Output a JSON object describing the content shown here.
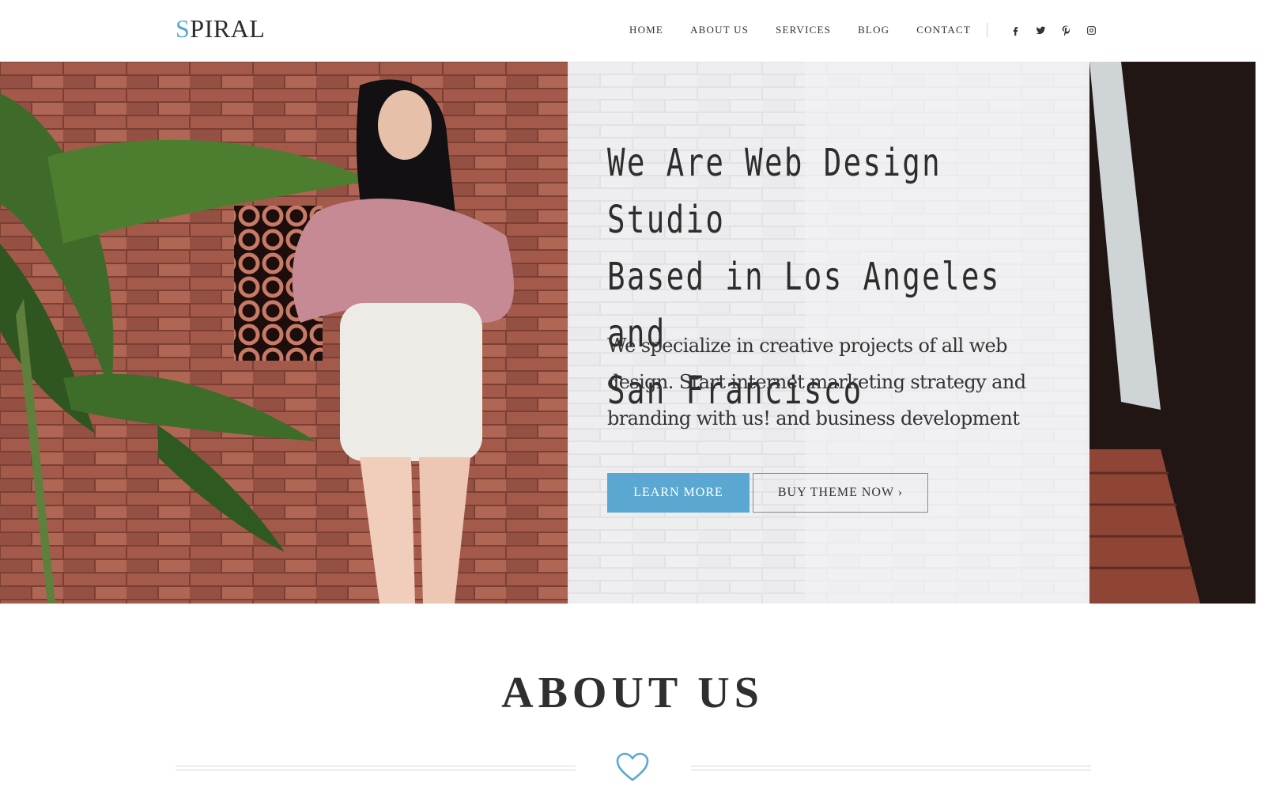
{
  "header": {
    "logo_first": "S",
    "logo_rest": "PIRAL",
    "nav": [
      "HOME",
      "ABOUT US",
      "SERVICES",
      "BLOG",
      "CONTACT"
    ],
    "social_icons": [
      "facebook-icon",
      "twitter-icon",
      "pinterest-icon",
      "instagram-icon"
    ]
  },
  "hero": {
    "title_lines": [
      "We Are Web Design Studio",
      "Based in Los Angeles and",
      "San Francisco"
    ],
    "description": "We specialize in creative projects of all web design. Start internet marketing strategy and branding with us! and business development",
    "primary_button": "LEARN MORE",
    "secondary_button": "BUY THEME NOW ›"
  },
  "about": {
    "title": "ABOUT US",
    "divider_icon": "heart-icon"
  },
  "colors": {
    "accent": "#5aa8d2",
    "text": "#2b2b2b"
  }
}
